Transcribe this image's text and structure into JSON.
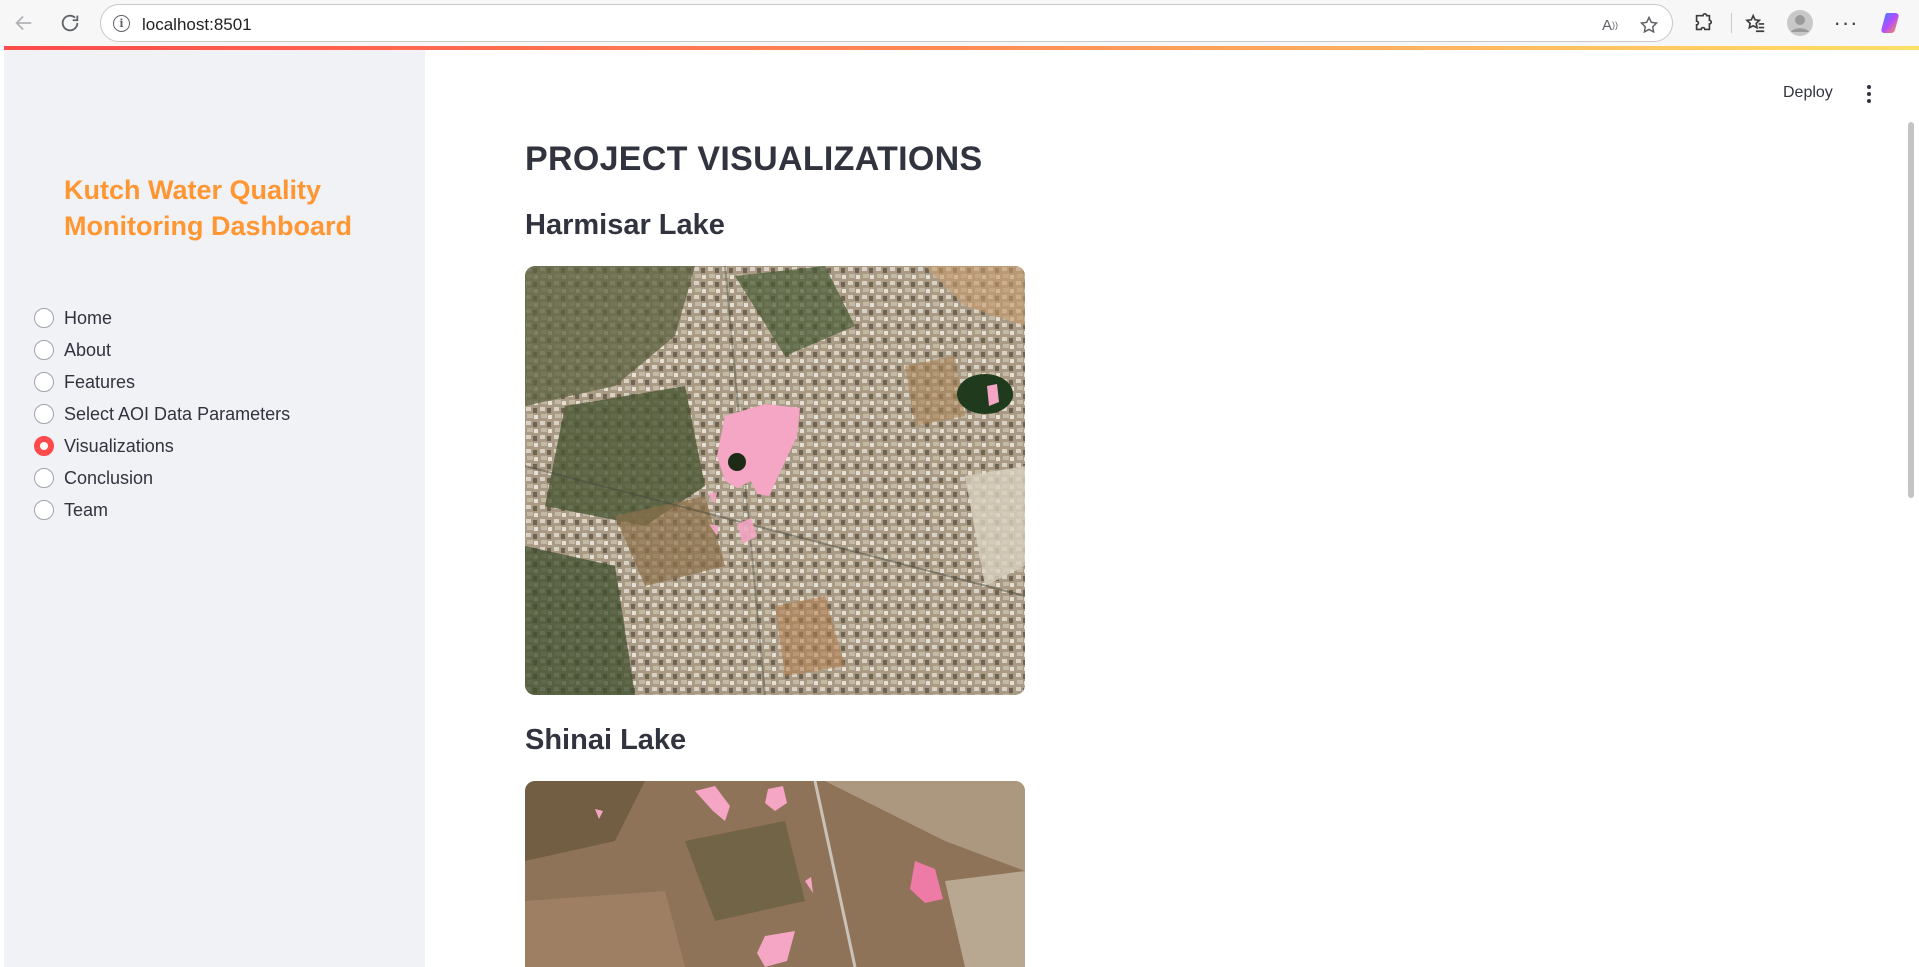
{
  "browser": {
    "url": "localhost:8501"
  },
  "sidebar": {
    "title": "Kutch Water Quality Monitoring Dashboard",
    "nav_items": [
      {
        "label": "Home",
        "selected": false
      },
      {
        "label": "About",
        "selected": false
      },
      {
        "label": "Features",
        "selected": false
      },
      {
        "label": "Select AOI Data Parameters",
        "selected": false
      },
      {
        "label": "Visualizations",
        "selected": true
      },
      {
        "label": "Conclusion",
        "selected": false
      },
      {
        "label": "Team",
        "selected": false
      }
    ]
  },
  "header": {
    "deploy_label": "Deploy"
  },
  "main": {
    "page_title": "PROJECT VISUALIZATIONS",
    "sections": [
      {
        "heading": "Harmisar Lake"
      },
      {
        "heading": "Shinai Lake"
      }
    ]
  },
  "colors": {
    "accent": "#ff4b4b",
    "sidebar_title": "#ff9632",
    "sidebar_bg": "#f0f2f6",
    "water_mask": "#f4a6c4"
  },
  "icons": {
    "back": "back-arrow-icon",
    "reload": "reload-icon",
    "info": "info-icon",
    "read_aloud": "read-aloud-icon",
    "favorite": "star-icon",
    "extensions": "puzzle-icon",
    "favorites": "favorites-icon",
    "profile": "profile-icon",
    "more": "more-icon",
    "copilot": "copilot-icon",
    "app_menu": "kebab-menu-icon"
  }
}
